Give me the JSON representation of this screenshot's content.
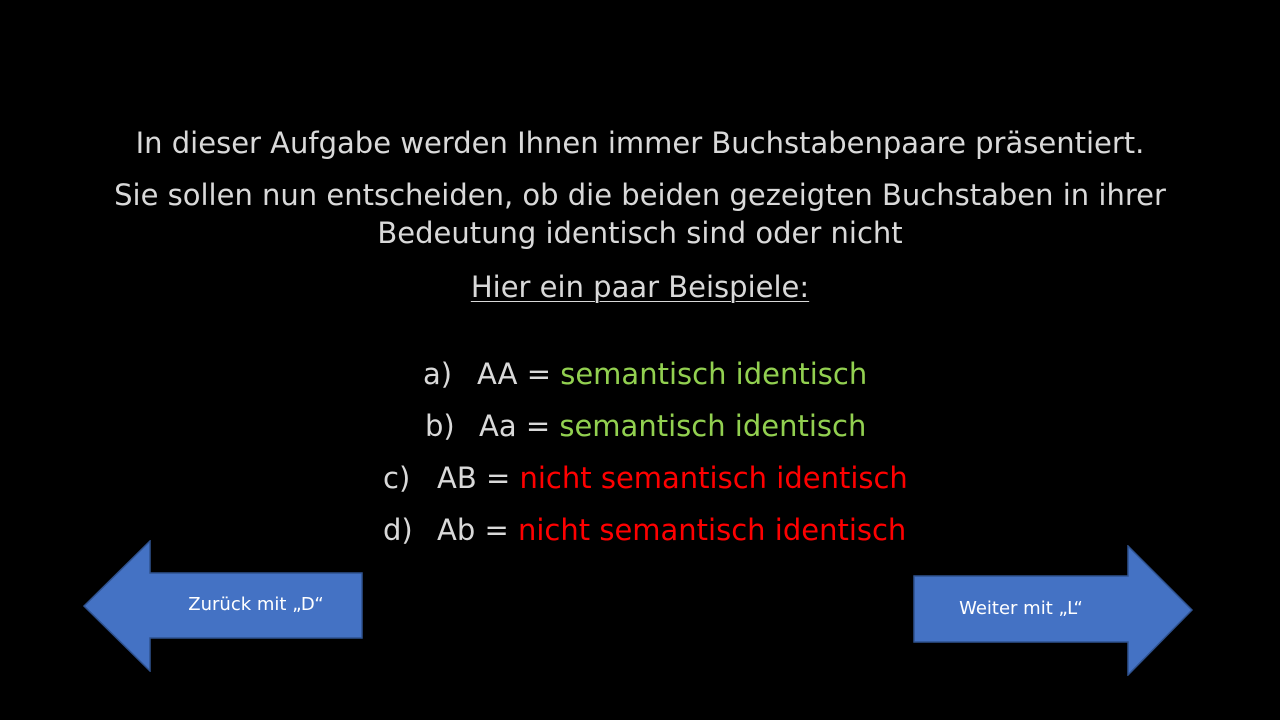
{
  "instructions": {
    "line1": "In dieser Aufgabe werden Ihnen immer Buchstabenpaare präsentiert.",
    "line2": "Sie sollen nun entscheiden, ob die beiden gezeigten Buchstaben in ihrer",
    "line3": "Bedeutung identisch sind oder nicht",
    "examples_heading": "Hier ein paar Beispiele:"
  },
  "examples": [
    {
      "letter": "a)",
      "pair": "AA =",
      "result": "semantisch identisch"
    },
    {
      "letter": "b)",
      "pair": "Aa =",
      "result": "semantisch identisch"
    },
    {
      "letter": "c)",
      "pair": "AB =",
      "result": "nicht semantisch identisch"
    },
    {
      "letter": "d)",
      "pair": "Ab =",
      "result": "nicht semantisch identisch"
    }
  ],
  "navigation": {
    "back_label": "Zurück mit „D“",
    "next_label": "Weiter mit „L“"
  },
  "colors": {
    "background": "#000000",
    "text": "#d9d9d9",
    "identical": "#92d050",
    "not_identical": "#ff0000",
    "arrow_fill": "#4472c4"
  }
}
